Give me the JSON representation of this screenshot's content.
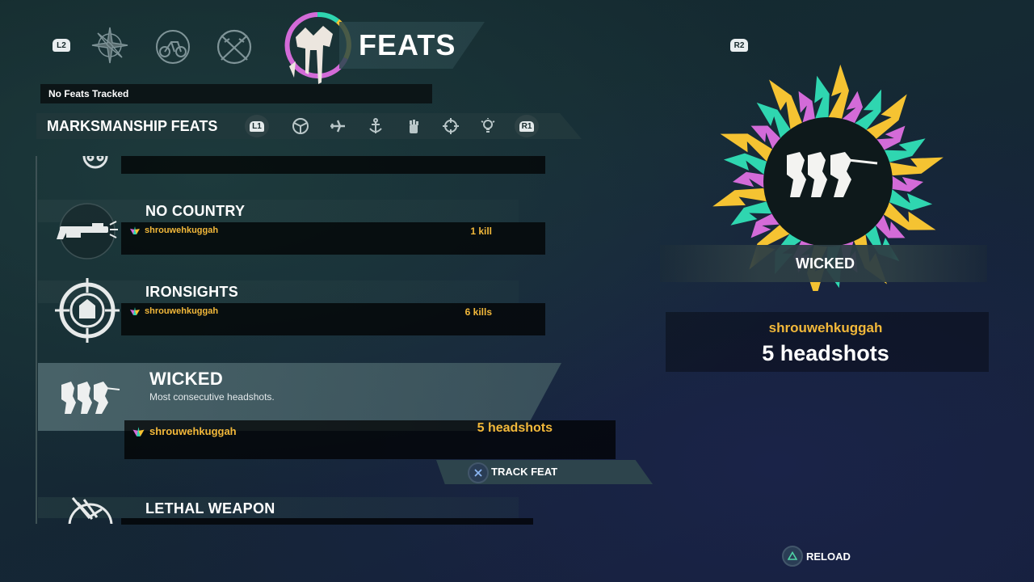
{
  "header": {
    "left_trigger": "L2",
    "right_trigger": "R2",
    "title": "FEATS",
    "tabs": [
      "compass-icon",
      "bike-icon",
      "crossed-guns-icon",
      "feats-emblem-icon"
    ]
  },
  "tracked": {
    "text": "No Feats Tracked"
  },
  "category": {
    "title": "MARKSMANSHIP FEATS",
    "left_shoulder": "L1",
    "right_shoulder": "R1",
    "icons": [
      "steering-wheel-icon",
      "plane-icon",
      "anchor-icon",
      "fist-icon",
      "crosshair-icon",
      "lightbulb-icon"
    ]
  },
  "feats": [
    {
      "name": "NO COUNTRY",
      "player": "shrouwehkuggah",
      "score": "1 kill",
      "icon": "shotgun-icon"
    },
    {
      "name": "IRONSIGHTS",
      "player": "shrouwehkuggah",
      "score": "6 kills",
      "icon": "ironsights-icon"
    },
    {
      "name": "WICKED",
      "description": "Most consecutive headshots.",
      "player": "shrouwehkuggah",
      "score": "5 headshots",
      "icon": "heads-icon",
      "selected": true
    },
    {
      "name": "LETHAL WEAPON",
      "icon": "lethal-weapon-icon"
    }
  ],
  "actions": {
    "track": "TRACK FEAT",
    "reload": "RELOAD"
  },
  "detail": {
    "name": "WICKED",
    "player": "shrouwehkuggah",
    "value": "5 headshots"
  },
  "colors": {
    "accent_gold": "#f2b83a",
    "burst_pink": "#d36bd8",
    "burst_teal": "#2fd6b0",
    "burst_yellow": "#f5c332"
  }
}
